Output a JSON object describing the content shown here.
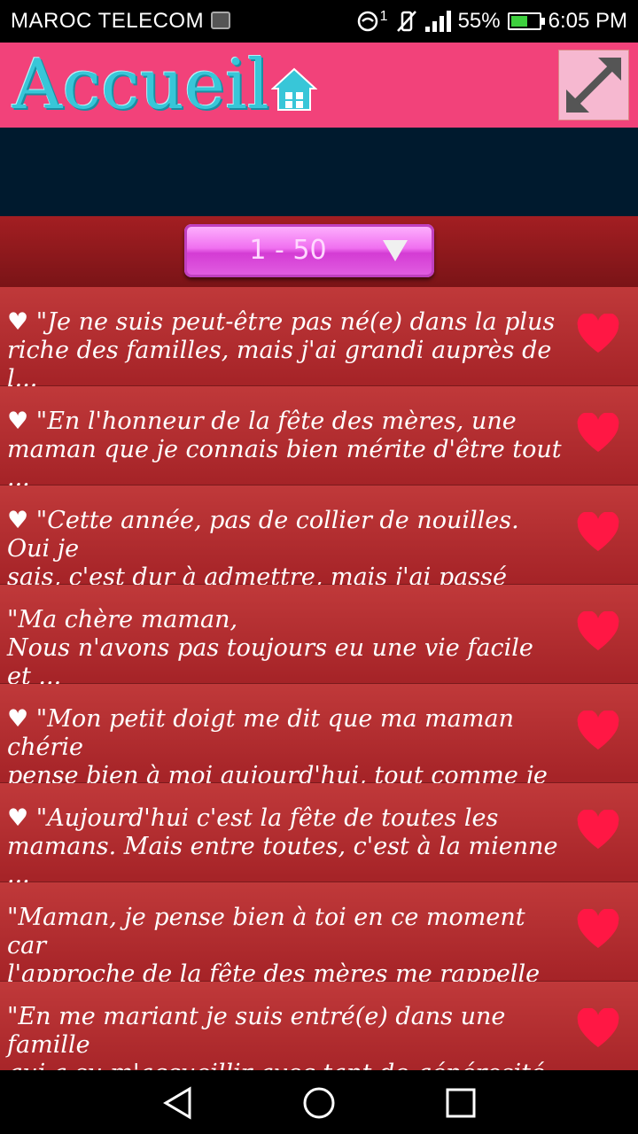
{
  "status": {
    "carrier": "MAROC TELECOM",
    "sim": "1",
    "battery": "55%",
    "time": "6:05 PM"
  },
  "header": {
    "logo_text": "Accueil",
    "home_icon": "home-icon",
    "expand_icon": "expand-icon"
  },
  "selector": {
    "value": "1 - 50"
  },
  "quotes": [
    {
      "text": "♥ \"Je ne suis peut-être pas né(e) dans la plus\nriche des familles, mais j'ai grandi auprès de l..."
    },
    {
      "text": "♥ \"En l'honneur de la fête des mères, une\nmaman que je connais bien mérite d'être tout ..."
    },
    {
      "text": "♥ \"Cette année, pas de collier de nouilles. Oui je\nsais, c'est dur à admettre, mais j'ai passé l'âge ..."
    },
    {
      "text": "\"Ma chère maman,\nNous n'avons pas toujours eu une vie facile et ..."
    },
    {
      "text": "♥ \"Mon petit doigt me dit que ma maman chérie\npense bien à moi aujourd'hui, tout comme je p..."
    },
    {
      "text": "♥ \"Aujourd'hui c'est la fête de toutes les\nmamans. Mais entre toutes, c'est à la mienne ..."
    },
    {
      "text": "\"Maman, je pense bien à toi en ce moment car\nl'approche de la fête des mères me rappelle ta..."
    },
    {
      "text": "\"En me mariant je suis entré(e) dans une famille\nqui a su m'accueillir avec tant de générosité ! ..."
    }
  ],
  "colors": {
    "header": "#f2427a",
    "row": "#b02b2e",
    "heart": "#ff1744",
    "logo": "#38c6d8"
  }
}
